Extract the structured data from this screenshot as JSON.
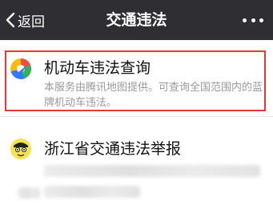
{
  "nav": {
    "back_label": "返回",
    "title": "交通违法"
  },
  "items": [
    {
      "title": "机动车违法查询",
      "description": "本服务由腾讯地图提供。可查询全国范围内的蓝牌机动车违法。",
      "icon": "tencent-map-logo-icon"
    },
    {
      "title": "浙江省交通违法举报",
      "icon": "cartoon-avatar-icon"
    }
  ],
  "colors": {
    "navbar": "#2f2f33",
    "highlight": "#e53935",
    "description": "#9a9a9a"
  }
}
